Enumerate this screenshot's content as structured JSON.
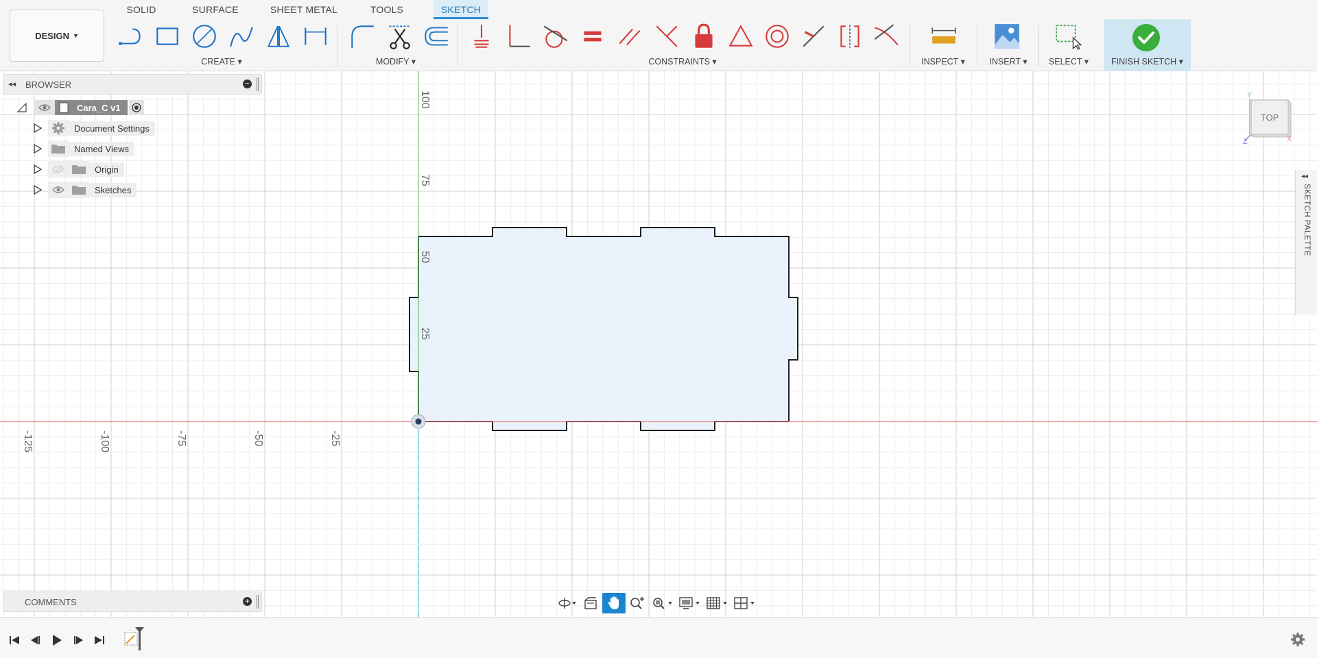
{
  "workspace": {
    "label": "DESIGN"
  },
  "tabs": [
    {
      "label": "SOLID",
      "active": false
    },
    {
      "label": "SURFACE",
      "active": false
    },
    {
      "label": "SHEET METAL",
      "active": false
    },
    {
      "label": "TOOLS",
      "active": false
    },
    {
      "label": "SKETCH",
      "active": true
    }
  ],
  "toolbar_groups": {
    "create": "CREATE",
    "modify": "MODIFY",
    "constraints": "CONSTRAINTS",
    "inspect": "INSPECT",
    "insert": "INSERT",
    "select": "SELECT",
    "finish": "FINISH SKETCH"
  },
  "browser": {
    "title": "BROWSER",
    "items": [
      {
        "label": "Cara_C v1"
      },
      {
        "label": "Document Settings"
      },
      {
        "label": "Named Views"
      },
      {
        "label": "Origin"
      },
      {
        "label": "Sketches"
      }
    ]
  },
  "comments": {
    "title": "COMMENTS"
  },
  "viewcube": {
    "face": "TOP",
    "axes": [
      "Y",
      "X",
      "Z"
    ]
  },
  "sketch_palette": {
    "label": "SKETCH PALETTE"
  },
  "axis_labels": {
    "x": [
      "-125",
      "-100",
      "-75",
      "-50",
      "-25"
    ],
    "y": [
      "100",
      "75",
      "50",
      "25"
    ]
  },
  "colors": {
    "accent": "#2a8ad4",
    "sketch_fill": "#eaf3fc",
    "x_axis": "#e06666",
    "y_axis": "#5bbf5b",
    "finish_green": "#3aae3a"
  }
}
